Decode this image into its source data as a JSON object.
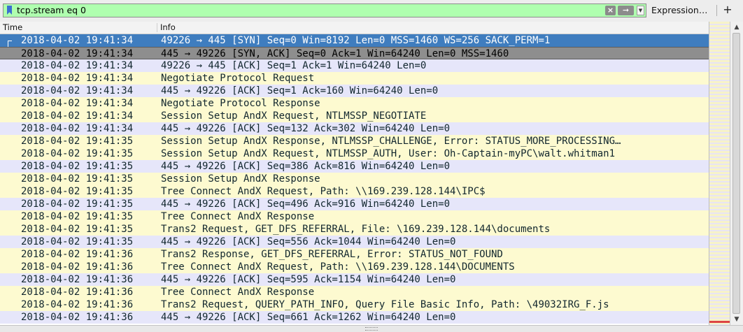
{
  "filter": {
    "value": "tcp.stream eq 0",
    "apply_icon": "arrow-right-icon",
    "clear_icon": "clear-x-icon",
    "bookmark_icon": "bookmark-icon",
    "dropdown_icon": "chevron-down-icon"
  },
  "toolbar": {
    "expression_label": "Expression…",
    "add_label": "+"
  },
  "columns": {
    "time": "Time",
    "info": "Info"
  },
  "colors": {
    "filter_valid": "#afffaf",
    "row_yellow": "#fdfad0",
    "row_lavender": "#e6e6fa",
    "selected": "#3f7dbf",
    "related": "#8e8e8e"
  },
  "packets": [
    {
      "time": "2018-04-02 19:41:34",
      "info": "49226 → 445 [SYN] Seq=0 Win=8192 Len=0 MSS=1460 WS=256 SACK_PERM=1",
      "style": "sel"
    },
    {
      "time": "2018-04-02 19:41:34",
      "info": "445 → 49226 [SYN, ACK] Seq=0 Ack=1 Win=64240 Len=0 MSS=1460",
      "style": "sel2"
    },
    {
      "time": "2018-04-02 19:41:34",
      "info": "49226 → 445 [ACK] Seq=1 Ack=1 Win=64240 Len=0",
      "style": "b"
    },
    {
      "time": "2018-04-02 19:41:34",
      "info": "Negotiate Protocol Request",
      "style": "y"
    },
    {
      "time": "2018-04-02 19:41:34",
      "info": "445 → 49226 [ACK] Seq=1 Ack=160 Win=64240 Len=0",
      "style": "b"
    },
    {
      "time": "2018-04-02 19:41:34",
      "info": "Negotiate Protocol Response",
      "style": "y"
    },
    {
      "time": "2018-04-02 19:41:34",
      "info": "Session Setup AndX Request, NTLMSSP_NEGOTIATE",
      "style": "y"
    },
    {
      "time": "2018-04-02 19:41:34",
      "info": "445 → 49226 [ACK] Seq=132 Ack=302 Win=64240 Len=0",
      "style": "b"
    },
    {
      "time": "2018-04-02 19:41:35",
      "info": "Session Setup AndX Response, NTLMSSP_CHALLENGE, Error: STATUS_MORE_PROCESSING…",
      "style": "y"
    },
    {
      "time": "2018-04-02 19:41:35",
      "info": "Session Setup AndX Request, NTLMSSP_AUTH, User: Oh-Captain-myPC\\walt.whitman1",
      "style": "y"
    },
    {
      "time": "2018-04-02 19:41:35",
      "info": "445 → 49226 [ACK] Seq=386 Ack=816 Win=64240 Len=0",
      "style": "b"
    },
    {
      "time": "2018-04-02 19:41:35",
      "info": "Session Setup AndX Response",
      "style": "y"
    },
    {
      "time": "2018-04-02 19:41:35",
      "info": "Tree Connect AndX Request, Path: \\\\169.239.128.144\\IPC$",
      "style": "y"
    },
    {
      "time": "2018-04-02 19:41:35",
      "info": "445 → 49226 [ACK] Seq=496 Ack=916 Win=64240 Len=0",
      "style": "b"
    },
    {
      "time": "2018-04-02 19:41:35",
      "info": "Tree Connect AndX Response",
      "style": "y"
    },
    {
      "time": "2018-04-02 19:41:35",
      "info": "Trans2 Request, GET_DFS_REFERRAL, File: \\169.239.128.144\\documents",
      "style": "y"
    },
    {
      "time": "2018-04-02 19:41:35",
      "info": "445 → 49226 [ACK] Seq=556 Ack=1044 Win=64240 Len=0",
      "style": "b"
    },
    {
      "time": "2018-04-02 19:41:36",
      "info": "Trans2 Response, GET_DFS_REFERRAL, Error: STATUS_NOT_FOUND",
      "style": "y"
    },
    {
      "time": "2018-04-02 19:41:36",
      "info": "Tree Connect AndX Request, Path: \\\\169.239.128.144\\DOCUMENTS",
      "style": "y"
    },
    {
      "time": "2018-04-02 19:41:36",
      "info": "445 → 49226 [ACK] Seq=595 Ack=1154 Win=64240 Len=0",
      "style": "b"
    },
    {
      "time": "2018-04-02 19:41:36",
      "info": "Tree Connect AndX Response",
      "style": "y"
    },
    {
      "time": "2018-04-02 19:41:36",
      "info": "Trans2 Request, QUERY_PATH_INFO, Query File Basic Info, Path: \\49032IRG_F.js",
      "style": "y"
    },
    {
      "time": "2018-04-02 19:41:36",
      "info": "445 → 49226 [ACK] Seq=661 Ack=1262 Win=64240 Len=0",
      "style": "b"
    }
  ]
}
